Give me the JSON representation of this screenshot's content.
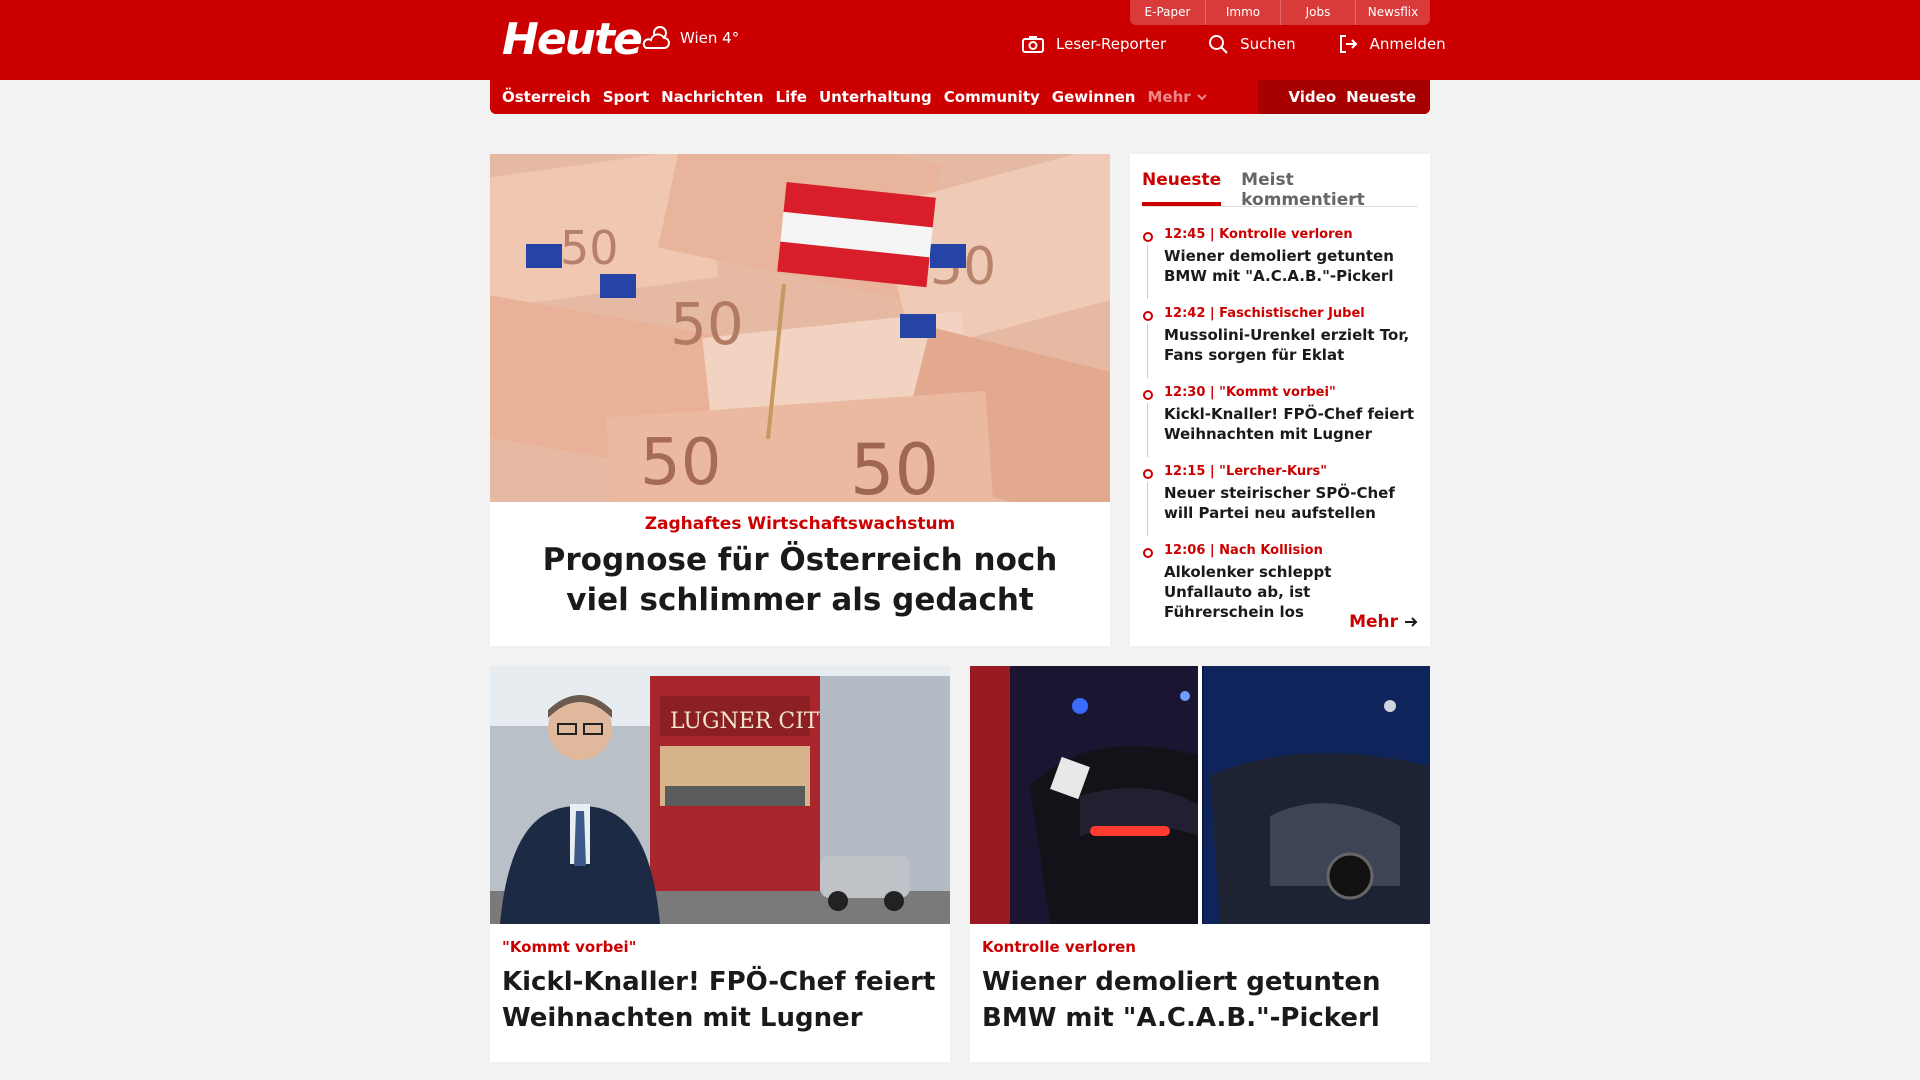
{
  "header": {
    "logo": "Heute",
    "weather": "Wien 4°",
    "utility_links": [
      "E-Paper",
      "Immo",
      "Jobs",
      "Newsflix"
    ],
    "actions": {
      "reporter": "Leser-Reporter",
      "search": "Suchen",
      "login": "Anmelden"
    }
  },
  "nav": {
    "items": [
      "Österreich",
      "Sport",
      "Nachrichten",
      "Life",
      "Unterhaltung",
      "Community",
      "Gewinnen"
    ],
    "more": "Mehr",
    "right": [
      "Video",
      "Neueste"
    ]
  },
  "hero": {
    "kicker": "Zaghaftes Wirtschaftswachstum",
    "headline": "Prognose für Österreich noch viel schlimmer als gedacht"
  },
  "sidebar": {
    "tabs": [
      "Neueste",
      "Meist kommentiert"
    ],
    "items": [
      {
        "meta": "12:45 | Kontrolle verloren",
        "title": "Wiener demoliert getunten BMW mit \"A.C.A.B.\"-Pickerl"
      },
      {
        "meta": "12:42 | Faschistischer Jubel",
        "title": "Mussolini-Urenkel erzielt Tor, Fans sorgen für Eklat"
      },
      {
        "meta": "12:30 | \"Kommt vorbei\"",
        "title": "Kickl-Knaller! FPÖ-Chef feiert Weihnachten mit Lugner"
      },
      {
        "meta": "12:15 | \"Lercher-Kurs\"",
        "title": "Neuer steirischer SPÖ-Chef will Partei neu aufstellen"
      },
      {
        "meta": "12:06 | Nach Kollision",
        "title": "Alkolenker schleppt Unfallauto ab, ist Führerschein los"
      }
    ],
    "more": "Mehr"
  },
  "cards": [
    {
      "kicker": "\"Kommt vorbei\"",
      "headline": "Kickl-Knaller! FPÖ-Chef feiert Weihnachten mit Lugner"
    },
    {
      "kicker": "Kontrolle verloren",
      "headline": "Wiener demoliert getunten BMW mit \"A.C.A.B.\"-Pickerl"
    }
  ],
  "colors": {
    "brand": "#cc0000",
    "background": "#f2f2f2"
  },
  "icons": [
    "weather-cloud-icon",
    "camera-icon",
    "search-icon",
    "login-icon",
    "chevron-down-icon",
    "arrow-right-icon"
  ]
}
